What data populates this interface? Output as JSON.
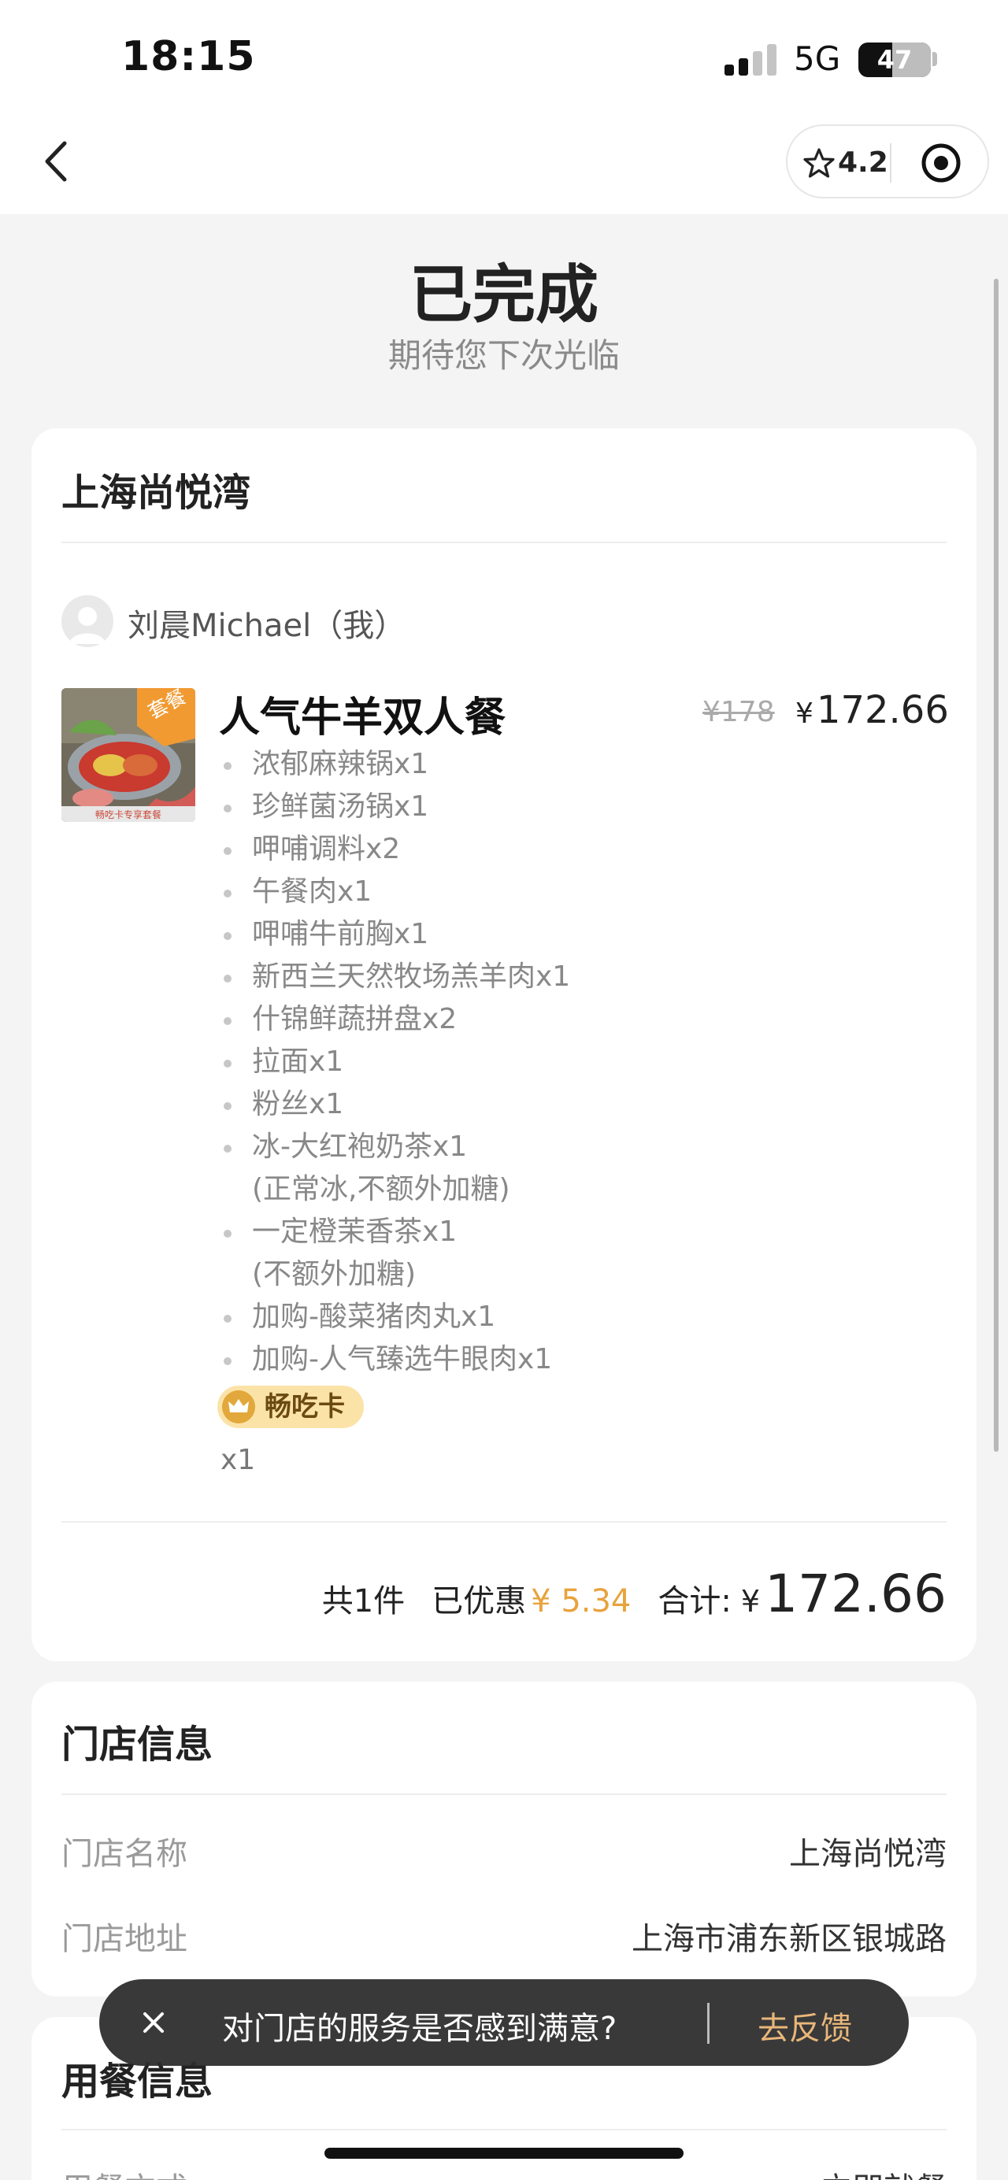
{
  "status_bar": {
    "time": "18:15",
    "network": "5G",
    "battery": "47",
    "battery_level": 0.47
  },
  "nav": {
    "rating": "4.2",
    "icons": [
      "back-icon",
      "star-icon",
      "target-icon"
    ]
  },
  "order_status": {
    "title": "已完成",
    "subtitle": "期待您下次光临"
  },
  "order_card": {
    "store_name": "上海尚悦湾",
    "user_name": "刘晨Michael（我）",
    "item": {
      "name": "人气牛羊双人餐",
      "badge": "套餐",
      "thumb_caption": "畅吃卡专享套餐",
      "original_price": "¥178",
      "price_symbol": "¥",
      "price": "172.66",
      "sub_items": [
        {
          "text": "浓郁麻辣锅x1",
          "note": ""
        },
        {
          "text": "珍鲜菌汤锅x1",
          "note": ""
        },
        {
          "text": "呷哺调料x2",
          "note": ""
        },
        {
          "text": "午餐肉x1",
          "note": ""
        },
        {
          "text": "呷哺牛前胸x1",
          "note": ""
        },
        {
          "text": "新西兰天然牧场羔羊肉x1",
          "note": ""
        },
        {
          "text": "什锦鲜蔬拼盘x2",
          "note": ""
        },
        {
          "text": "拉面x1",
          "note": ""
        },
        {
          "text": "粉丝x1",
          "note": ""
        },
        {
          "text": "冰-大红袍奶茶x1",
          "note": "(正常冰,不额外加糖)"
        },
        {
          "text": "一定橙茉香茶x1",
          "note": "(不额外加糖)"
        },
        {
          "text": "加购-酸菜猪肉丸x1",
          "note": ""
        },
        {
          "text": "加购-人气臻选牛眼肉x1",
          "note": ""
        }
      ],
      "vip_tag": "畅吃卡",
      "quantity": "x1"
    },
    "summary": {
      "count_label": "共1件",
      "discount_label": "已优惠",
      "discount_value": "¥ 5.34",
      "total_label": "合计:",
      "total_symbol": "¥",
      "total_value": "172.66"
    }
  },
  "store_card": {
    "title": "门店信息",
    "rows": [
      {
        "key": "门店名称",
        "value": "上海尚悦湾"
      },
      {
        "key": "门店地址",
        "value": "上海市浦东新区银城路"
      }
    ]
  },
  "dining_card": {
    "title": "用餐信息",
    "partial_key": "用餐方式",
    "partial_value": "立即就餐"
  },
  "toast": {
    "text": "对门店的服务是否感到满意?",
    "action": "去反馈"
  },
  "colors": {
    "accent_orange": "#e8a33d",
    "toast_link": "#e9b77a",
    "vip_tag_bg": "#fbe3a8"
  }
}
